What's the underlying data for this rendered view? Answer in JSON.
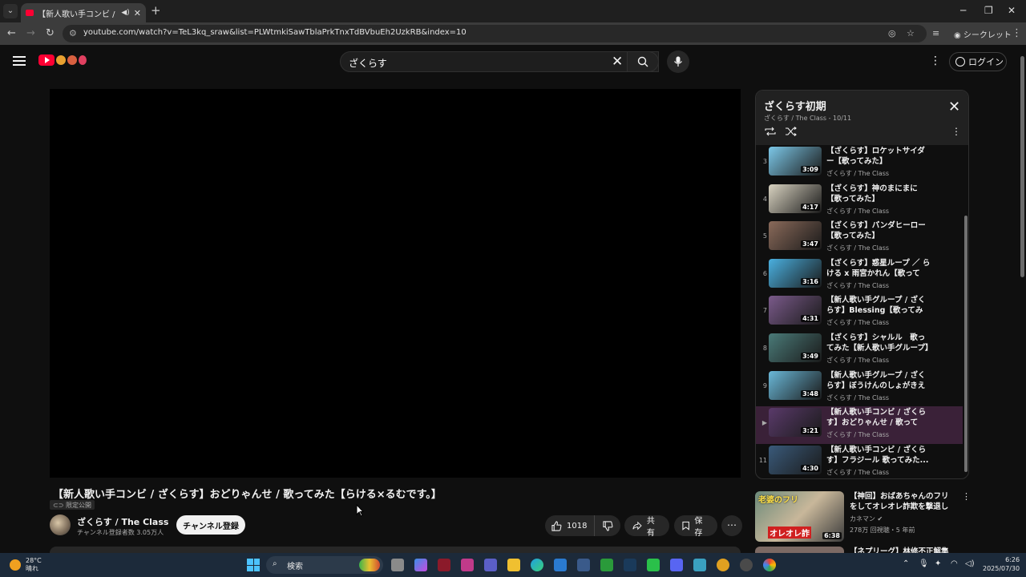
{
  "browser": {
    "tab_title": "【新人歌い手コンビ / ざくらす】おどりゃんせ",
    "url": "youtube.com/watch?v=TeL3kq_sraw&list=PLWtmkiSawTblaPrkTnxTdBVbuEh2UzkRB&index=10",
    "incognito_label": "シークレット"
  },
  "masthead": {
    "search_value": "ざくらす",
    "login_label": "ログイン"
  },
  "video": {
    "title": "【新人歌い手コンビ / ざくらす】おどりゃんせ / 歌ってみた【らける×るむです。】",
    "unlisted_label": "限定公開",
    "channel_name": "ざくらす / The Class",
    "subscribers": "チャンネル登録者数 3.05万人",
    "subscribe_label": "チャンネル登録",
    "likes": "1018",
    "share_label": "共有",
    "save_label": "保存"
  },
  "playlist": {
    "title": "ざくらす初期",
    "subtitle": "ざくらす / The Class - 10/11",
    "items": [
      {
        "index": "3",
        "title": "【ざくらす】ロケットサイダー【歌ってみた】",
        "channel": "ざくらす / The Class",
        "duration": "3:09",
        "color": "#7cc8e8",
        "active": false
      },
      {
        "index": "4",
        "title": "【ざくらす】神のまにまに【歌ってみた】",
        "channel": "ざくらす / The Class",
        "duration": "4:17",
        "color": "#d8d2c0",
        "active": false
      },
      {
        "index": "5",
        "title": "【ざくらす】パンダヒーロー【歌ってみた】",
        "channel": "ざくらす / The Class",
        "duration": "3:47",
        "color": "#8a6a5a",
        "active": false
      },
      {
        "index": "6",
        "title": "【ざくらす】惑星ループ ／ らける x 雨宮かれん【歌ってみ...",
        "channel": "ざくらす / The Class",
        "duration": "3:16",
        "color": "#4ab0e0",
        "active": false
      },
      {
        "index": "7",
        "title": "【新人歌い手グループ / ざくらす】Blessing【歌ってみた】",
        "channel": "ざくらす / The Class",
        "duration": "4:31",
        "color": "#7a5a8a",
        "active": false
      },
      {
        "index": "8",
        "title": "【ざくらす】シャルル　歌ってみた【新人歌い手グループ】",
        "channel": "ざくらす / The Class",
        "duration": "3:49",
        "color": "#4a7a78",
        "active": false
      },
      {
        "index": "9",
        "title": "【新人歌い手グループ / ざくらす】ぼうけんのしょがきえま...",
        "channel": "ざくらす / The Class",
        "duration": "3:48",
        "color": "#6ab8d8",
        "active": false
      },
      {
        "index": "▶",
        "title": "【新人歌い手コンビ / ざくらす】おどりゃんせ / 歌ってみ...",
        "channel": "ざくらす / The Class",
        "duration": "3:21",
        "color": "#5a3a6a",
        "active": true
      },
      {
        "index": "11",
        "title": "【新人歌い手コンビ / ざくらす】フラジール 歌ってみた...",
        "channel": "ざくらす / The Class",
        "duration": "4:30",
        "color": "#3a5a7a",
        "active": false
      }
    ]
  },
  "recommendation": {
    "title": "【神回】おばあちゃんのフリをしてオレオレ詐欺を撃退して...",
    "channel": "カネマン",
    "meta": "278万 回視聴・5 年前",
    "duration": "6:38",
    "thumb_text": "老婆のフリ",
    "thumb_text2": "オレオレ詐"
  },
  "recommendation_next": {
    "title": "【ネプリーグ】林修不正解集"
  },
  "taskbar": {
    "temperature": "28°C",
    "weather": "晴れ",
    "search_label": "検索",
    "time": "6:26",
    "date": "2025/07/30"
  },
  "colors": {
    "accent": "#ff0033",
    "active_row": "#3a2138"
  }
}
